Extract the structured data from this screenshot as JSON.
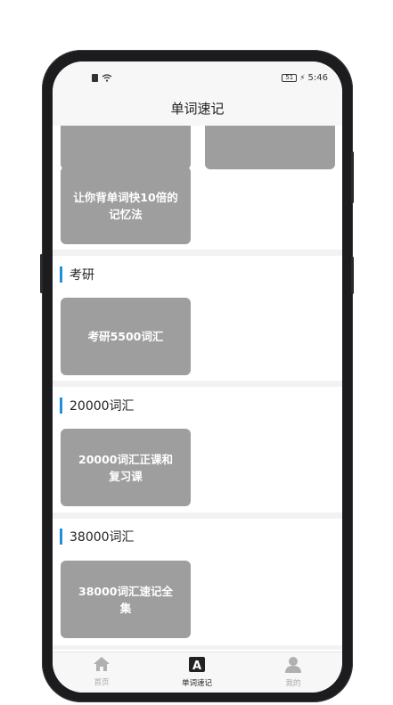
{
  "status_bar": {
    "time": "5:46",
    "battery": "51"
  },
  "header": {
    "title": "单词速记"
  },
  "sections": [
    {
      "cards": [
        "",
        "",
        "让你背单词快10倍的记忆法"
      ]
    },
    {
      "title": "考研",
      "cards": [
        "考研5500词汇"
      ]
    },
    {
      "title": "20000词汇",
      "cards": [
        "20000词汇正课和复习课"
      ]
    },
    {
      "title": "38000词汇",
      "cards": [
        "38000词汇速记全集"
      ]
    }
  ],
  "tabbar": {
    "items": [
      {
        "label": "首页",
        "icon": "home-icon"
      },
      {
        "label": "单词速记",
        "icon": "letter-a-icon",
        "active": true
      },
      {
        "label": "我的",
        "icon": "user-icon"
      }
    ]
  },
  "colors": {
    "accent": "#1e90e0",
    "card": "#9e9e9e"
  }
}
